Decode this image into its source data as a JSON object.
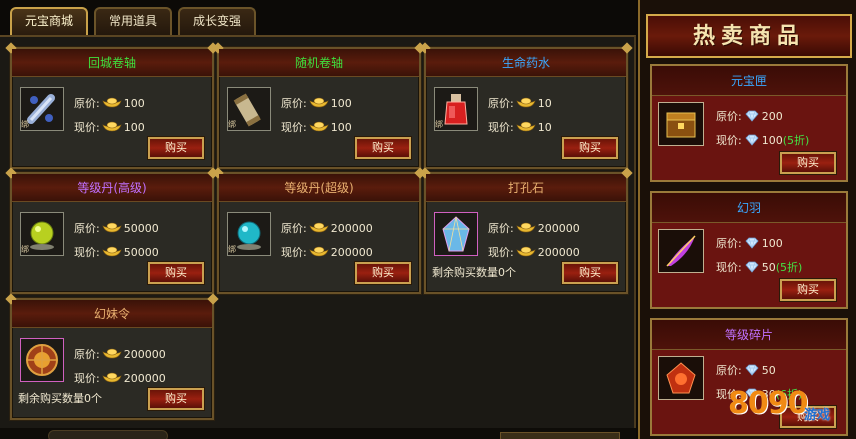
{
  "tabs": [
    {
      "label": "元宝商城",
      "active": true
    },
    {
      "label": "常用道具",
      "active": false
    },
    {
      "label": "成长变强",
      "active": false
    }
  ],
  "labels": {
    "original_price": "原价:",
    "current_price": "现价:",
    "buy": "购买",
    "bound": "绑"
  },
  "items": [
    {
      "name": "回城卷轴",
      "name_color": "#3ee03e",
      "original": "100",
      "current": "100",
      "icon": "return-scroll-icon",
      "remaining": ""
    },
    {
      "name": "随机卷轴",
      "name_color": "#3ee03e",
      "original": "100",
      "current": "100",
      "icon": "random-scroll-icon",
      "remaining": ""
    },
    {
      "name": "生命药水",
      "name_color": "#3aa8ff",
      "original": "10",
      "current": "10",
      "icon": "life-potion-icon",
      "remaining": ""
    },
    {
      "name": "等级丹(高级)",
      "name_color": "#c070ff",
      "original": "50000",
      "current": "50000",
      "icon": "green-orb-icon",
      "remaining": ""
    },
    {
      "name": "等级丹(超级)",
      "name_color": "#e8b070",
      "original": "200000",
      "current": "200000",
      "icon": "cyan-orb-icon",
      "remaining": ""
    },
    {
      "name": "打孔石",
      "name_color": "#e8b070",
      "original": "200000",
      "current": "200000",
      "icon": "gem-stone-icon",
      "remaining": "剩余购买数量0个"
    },
    {
      "name": "幻妹令",
      "name_color": "#e8b070",
      "original": "200000",
      "current": "200000",
      "icon": "seal-token-icon",
      "remaining": "剩余购买数量0个"
    }
  ],
  "hot": {
    "title": "热卖商品",
    "items": [
      {
        "name": "元宝匣",
        "name_color": "#3aa8ff",
        "original": "200",
        "current": "100",
        "discount": "(5折)",
        "icon": "treasure-chest-icon"
      },
      {
        "name": "幻羽",
        "name_color": "#3aa8ff",
        "original": "100",
        "current": "50",
        "discount": "(5折)",
        "icon": "feather-icon"
      },
      {
        "name": "等级碎片",
        "name_color": "#c070ff",
        "original": "50",
        "current": "30",
        "discount": "(6折)",
        "icon": "shard-icon"
      }
    ]
  },
  "watermark": {
    "brand": "8090",
    "sub": "游戏"
  }
}
